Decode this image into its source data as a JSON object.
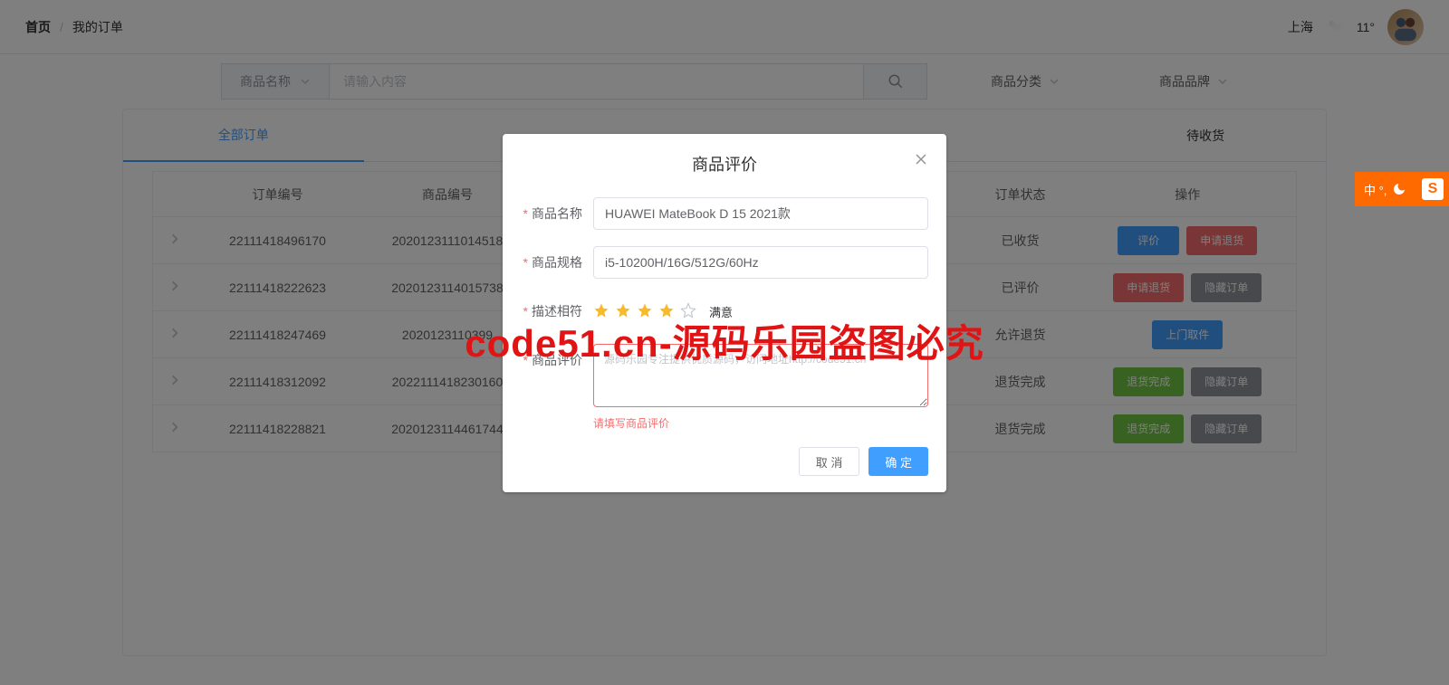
{
  "breadcrumb": {
    "home": "首页",
    "current": "我的订单"
  },
  "weather": {
    "city": "上海",
    "temp": "11°"
  },
  "search": {
    "filter_label": "商品名称",
    "placeholder": "请输入内容"
  },
  "right_filters": {
    "category": "商品分类",
    "brand": "商品品牌"
  },
  "tabs": {
    "all": "全部订单",
    "pending": "待收货"
  },
  "table": {
    "headers": {
      "order_no": "订单编号",
      "goods_no": "商品编号",
      "status": "订单状态",
      "ops": "操作"
    },
    "rows": [
      {
        "order_no": "22111418496170",
        "goods_no": "2020123111014518",
        "status": "已收货",
        "actions": [
          {
            "label": "评价",
            "type": "primary"
          },
          {
            "label": "申请退货",
            "type": "danger"
          }
        ]
      },
      {
        "order_no": "22111418222623",
        "goods_no": "2020123114015738",
        "status": "已评价",
        "actions": [
          {
            "label": "申请退货",
            "type": "danger"
          },
          {
            "label": "隐藏订单",
            "type": "info"
          }
        ]
      },
      {
        "order_no": "22111418247469",
        "goods_no": "2020123110399",
        "status": "允许退货",
        "actions": [
          {
            "label": "上门取件",
            "type": "primary"
          }
        ]
      },
      {
        "order_no": "22111418312092",
        "goods_no": "2022111418230160",
        "status": "退货完成",
        "actions": [
          {
            "label": "退货完成",
            "type": "success",
            "disabled": true
          },
          {
            "label": "隐藏订单",
            "type": "info"
          }
        ]
      },
      {
        "order_no": "22111418228821",
        "goods_no": "2020123114461744",
        "status": "退货完成",
        "actions": [
          {
            "label": "退货完成",
            "type": "success",
            "disabled": true
          },
          {
            "label": "隐藏订单",
            "type": "info"
          }
        ]
      }
    ]
  },
  "dialog": {
    "title": "商品评价",
    "labels": {
      "name": "商品名称",
      "spec": "商品规格",
      "match": "描述相符",
      "review": "商品评价"
    },
    "values": {
      "name": "HUAWEI MateBook D 15 2021款",
      "spec": "i5-10200H/16G/512G/60Hz"
    },
    "rate_text": "满意",
    "rate_value": 4,
    "textarea_placeholder": "源码乐园专注提供优质源码，访问地址http://code51.cn",
    "error": "请填写商品评价",
    "cancel": "取 消",
    "confirm": "确 定"
  },
  "watermark": "code51.cn-源码乐园盗图必究",
  "ime": {
    "left": "中 °, ",
    "badge": "S"
  }
}
